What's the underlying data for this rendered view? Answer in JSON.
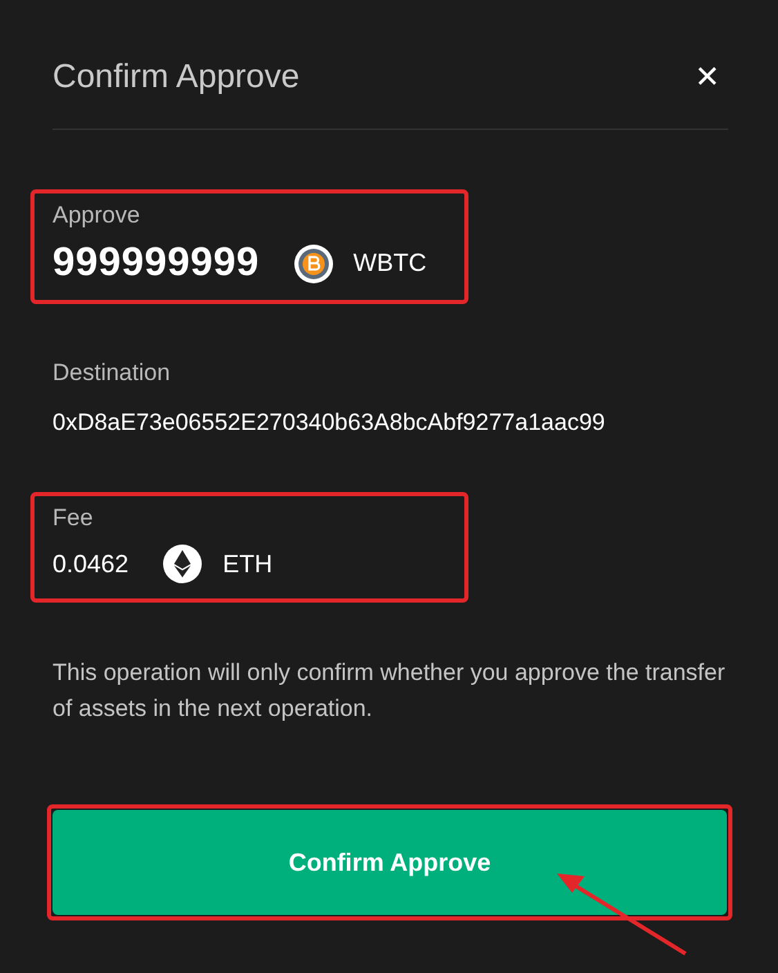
{
  "dialog": {
    "title": "Confirm Approve",
    "close": "✕"
  },
  "approve": {
    "label": "Approve",
    "amount": "999999999",
    "token": "WBTC"
  },
  "destination": {
    "label": "Destination",
    "address": "0xD8aE73e06552E270340b63A8bcAbf9277a1aac99"
  },
  "fee": {
    "label": "Fee",
    "amount": "0.0462",
    "token": "ETH"
  },
  "note": "This operation will only confirm whether you approve the transfer of assets in the next operation.",
  "button": "Confirm Approve"
}
